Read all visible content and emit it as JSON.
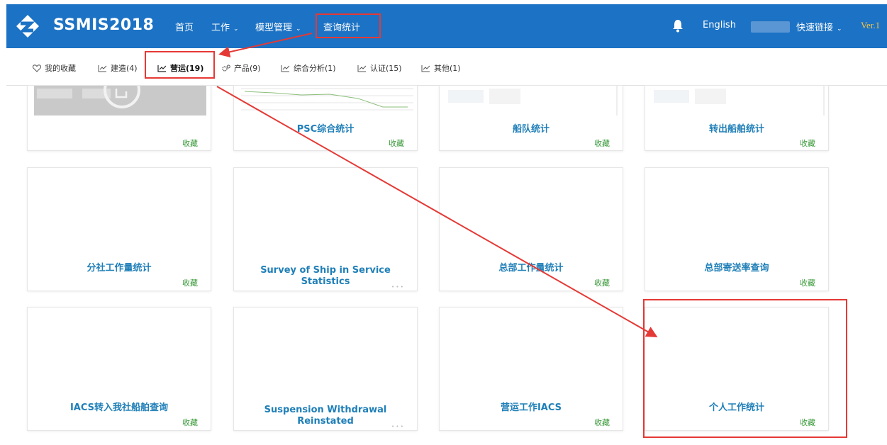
{
  "header": {
    "app_title": "SSMIS2018",
    "nav": [
      {
        "label": "首页"
      },
      {
        "label": "工作",
        "dropdown": true
      },
      {
        "label": "模型管理",
        "dropdown": true
      },
      {
        "label": "查询统计"
      }
    ],
    "language": "English",
    "quick_links": "快速链接",
    "version": "Ver.1"
  },
  "tabs": [
    {
      "label": "我的收藏",
      "icon": "heart-icon"
    },
    {
      "label": "建造(4)",
      "icon": "trend-icon"
    },
    {
      "label": "营运(19)",
      "icon": "trend-icon",
      "active": true
    },
    {
      "label": "产品(9)",
      "icon": "gears-icon"
    },
    {
      "label": "综合分析(1)",
      "icon": "trend-icon"
    },
    {
      "label": "认证(15)",
      "icon": "trend-icon"
    },
    {
      "label": "其他(1)",
      "icon": "trend-icon"
    }
  ],
  "cards": [
    {
      "title": "",
      "fav": "收藏"
    },
    {
      "title": "PSC综合统计",
      "fav": "收藏"
    },
    {
      "title": "船队统计",
      "fav": "收藏"
    },
    {
      "title": "转出船舶统计",
      "fav": "收藏"
    },
    {
      "title": "分社工作量统计",
      "fav": "收藏"
    },
    {
      "title": "Survey of Ship in Service Statistics",
      "fav": ""
    },
    {
      "title": "总部工作量统计",
      "fav": "收藏"
    },
    {
      "title": "总部寄送率查询",
      "fav": "收藏"
    },
    {
      "title": "IACS转入我社船舶查询",
      "fav": "收藏"
    },
    {
      "title": "Suspension Withdrawal Reinstated",
      "fav": ""
    },
    {
      "title": "营运工作IACS",
      "fav": "收藏"
    },
    {
      "title": "个人工作统计",
      "fav": "收藏"
    }
  ],
  "colors": {
    "header_bg": "#1c72c4",
    "title_blue": "#1f7fb8",
    "fav_green": "#3a9a3a",
    "annotation_red": "#e53935"
  }
}
